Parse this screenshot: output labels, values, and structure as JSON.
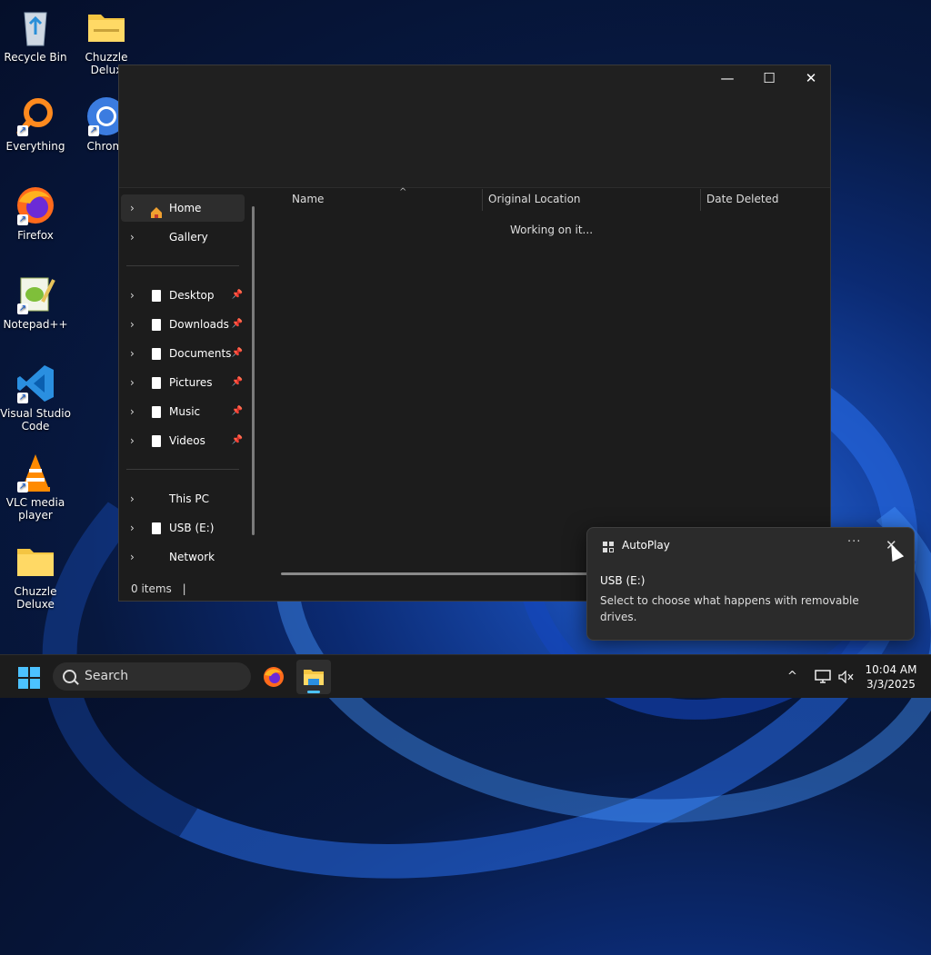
{
  "desktop": {
    "icons": [
      {
        "label": "Recycle Bin",
        "icon": "recycle-bin-icon",
        "shortcut": false
      },
      {
        "label": "Chuzzle Delux",
        "icon": "folder-icon",
        "shortcut": false
      },
      {
        "label": "Everything",
        "icon": "everything-icon",
        "shortcut": true
      },
      {
        "label": "Chromi",
        "icon": "chromium-icon",
        "shortcut": true
      },
      {
        "label": "Firefox",
        "icon": "firefox-icon",
        "shortcut": true
      },
      {
        "label": "Notepad++",
        "icon": "notepadpp-icon",
        "shortcut": true
      },
      {
        "label": "Visual Studio Code",
        "icon": "vscode-icon",
        "shortcut": true
      },
      {
        "label": "VLC media player",
        "icon": "vlc-icon",
        "shortcut": true
      },
      {
        "label": "Chuzzle Deluxe",
        "icon": "folder-icon",
        "shortcut": false
      }
    ]
  },
  "explorer": {
    "window_controls": {
      "minimize": "—",
      "maximize": "☐",
      "close": "✕"
    },
    "sidebar": {
      "items": [
        {
          "label": "Home",
          "icon": "home-icon",
          "pinned": false,
          "selected": true
        },
        {
          "label": "Gallery",
          "icon": "",
          "pinned": false
        },
        {
          "label": "Desktop",
          "icon": "document-icon",
          "pinned": true
        },
        {
          "label": "Downloads",
          "icon": "document-icon",
          "pinned": true
        },
        {
          "label": "Documents",
          "icon": "document-icon",
          "pinned": true
        },
        {
          "label": "Pictures",
          "icon": "document-icon",
          "pinned": true
        },
        {
          "label": "Music",
          "icon": "document-icon",
          "pinned": true
        },
        {
          "label": "Videos",
          "icon": "document-icon",
          "pinned": true
        },
        {
          "label": "This PC",
          "icon": "",
          "pinned": false
        },
        {
          "label": "USB (E:)",
          "icon": "document-icon",
          "pinned": false
        },
        {
          "label": "Network",
          "icon": "",
          "pinned": false
        }
      ]
    },
    "columns": [
      "Name",
      "Original Location",
      "Date Deleted"
    ],
    "loading_text": "Working on it...",
    "status": {
      "items": "0 items",
      "separator": "|"
    }
  },
  "toast": {
    "app_name": "AutoPlay",
    "more": "···",
    "close": "✕",
    "title": "USB (E:)",
    "body": "Select to choose what happens with removable drives."
  },
  "taskbar": {
    "search_label": "Search",
    "clock": {
      "time": "10:04 AM",
      "date": "3/3/2025"
    },
    "tray": {
      "chevron": "^"
    },
    "accent": "#4cc2ff"
  }
}
